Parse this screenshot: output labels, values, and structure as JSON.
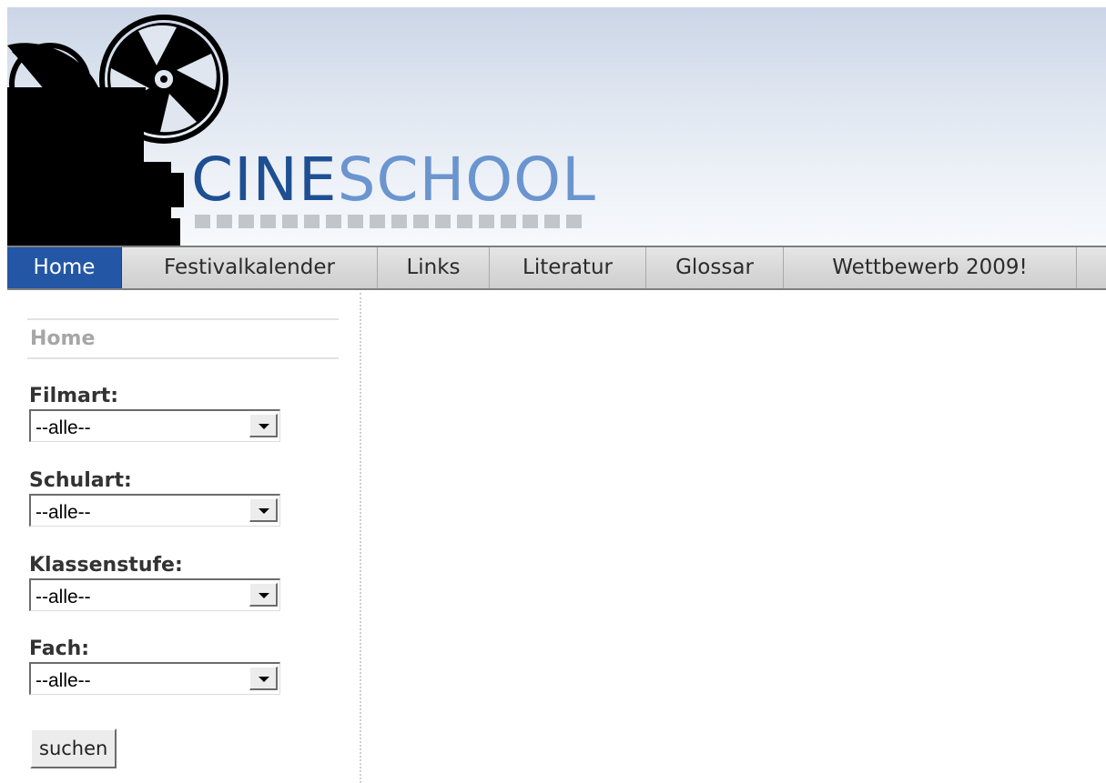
{
  "brand": {
    "logo_cine": "CINE",
    "logo_school": "SCHOOL"
  },
  "nav": {
    "items": [
      {
        "label": "Home",
        "active": true
      },
      {
        "label": "Festivalkalender",
        "active": false
      },
      {
        "label": "Links",
        "active": false
      },
      {
        "label": "Literatur",
        "active": false
      },
      {
        "label": "Glossar",
        "active": false
      },
      {
        "label": "Wettbewerb 2009!",
        "active": false
      }
    ]
  },
  "sidebar": {
    "section_title": "Home",
    "filters": [
      {
        "label": "Filmart:",
        "value": "--alle--"
      },
      {
        "label": "Schulart:",
        "value": "--alle--"
      },
      {
        "label": "Klassenstufe:",
        "value": "--alle--"
      },
      {
        "label": "Fach:",
        "value": "--alle--"
      }
    ],
    "search_button": "suchen"
  },
  "colors": {
    "nav_active": "#2357a6",
    "logo_dark": "#1f4f93",
    "logo_light": "#6a95cf"
  },
  "icons": [
    "film-projector-icon",
    "dropdown-arrow-icon"
  ]
}
